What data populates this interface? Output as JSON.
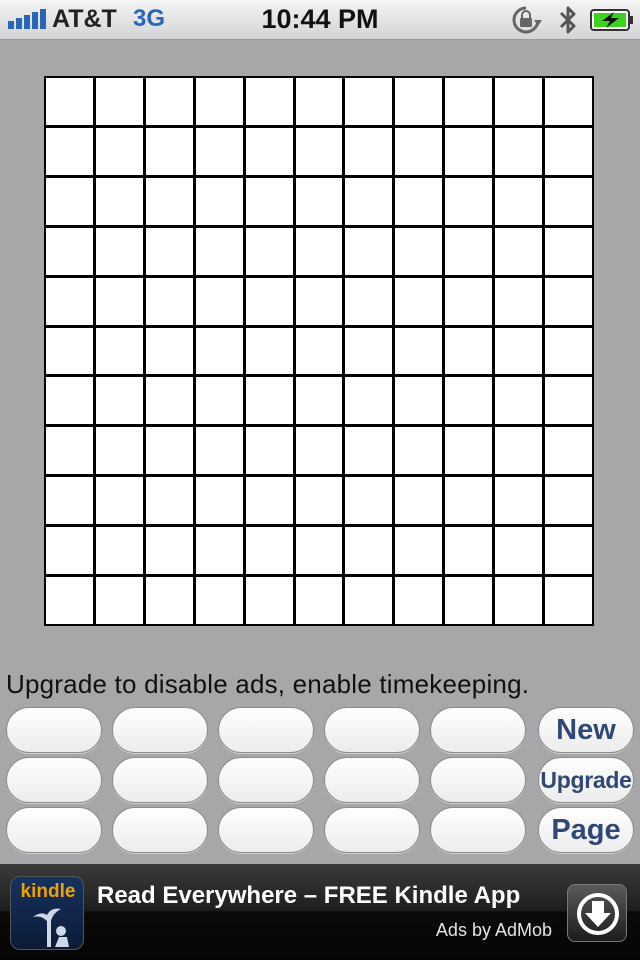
{
  "status_bar": {
    "carrier": "AT&T",
    "network": "3G",
    "time": "10:44 PM",
    "icons": [
      "signal-bars-icon",
      "rotation-lock-icon",
      "bluetooth-icon",
      "battery-charging-icon"
    ]
  },
  "grid": {
    "rows": 11,
    "columns": 11
  },
  "notice": "Upgrade to disable ads, enable timekeeping.",
  "keys": {
    "new_label": "New",
    "upgrade_label": "Upgrade",
    "page_label": "Page"
  },
  "ad": {
    "logo_text": "kindle",
    "title": "Read Everywhere – FREE Kindle App",
    "credit": "Ads by AdMob",
    "icon": "download-arrow-icon"
  },
  "colors": {
    "background": "#a7a7a9",
    "key_text": "#304878",
    "network": "#2a66b8",
    "kindle_orange": "#f0a000",
    "battery_green": "#3fd11f"
  }
}
